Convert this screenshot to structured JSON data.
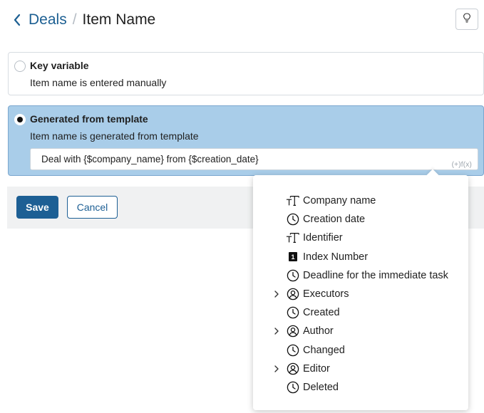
{
  "header": {
    "back_icon": "chevron-left-icon",
    "parent": "Deals",
    "separator": "/",
    "current": "Item Name",
    "help_icon": "help-lightbulb-icon",
    "accent_color": "#1c5f92"
  },
  "options": {
    "key_variable": {
      "title": "Key variable",
      "description": "Item name is entered manually",
      "selected": false
    },
    "generated": {
      "title": "Generated from template",
      "description": "Item name is generated from template",
      "selected": true,
      "template_value": "Deal with {$company_name} from {$creation_date}",
      "insert_icon": "(+)f(x)",
      "background": "#a9cde9"
    }
  },
  "footer": {
    "save_label": "Save",
    "cancel_label": "Cancel"
  },
  "dropdown": {
    "items": [
      {
        "label": "Company name",
        "icon": "text-type-icon",
        "expandable": false
      },
      {
        "label": "Creation date",
        "icon": "clock-icon",
        "expandable": false
      },
      {
        "label": "Identifier",
        "icon": "text-type-icon",
        "expandable": false
      },
      {
        "label": "Index Number",
        "icon": "index-number-icon",
        "expandable": false
      },
      {
        "label": "Deadline for the immediate task",
        "icon": "clock-icon",
        "expandable": false
      },
      {
        "label": "Executors",
        "icon": "user-icon",
        "expandable": true
      },
      {
        "label": "Created",
        "icon": "clock-icon",
        "expandable": false
      },
      {
        "label": "Author",
        "icon": "user-icon",
        "expandable": true
      },
      {
        "label": "Changed",
        "icon": "clock-icon",
        "expandable": false
      },
      {
        "label": "Editor",
        "icon": "user-icon",
        "expandable": true
      },
      {
        "label": "Deleted",
        "icon": "clock-icon",
        "expandable": false
      }
    ]
  }
}
